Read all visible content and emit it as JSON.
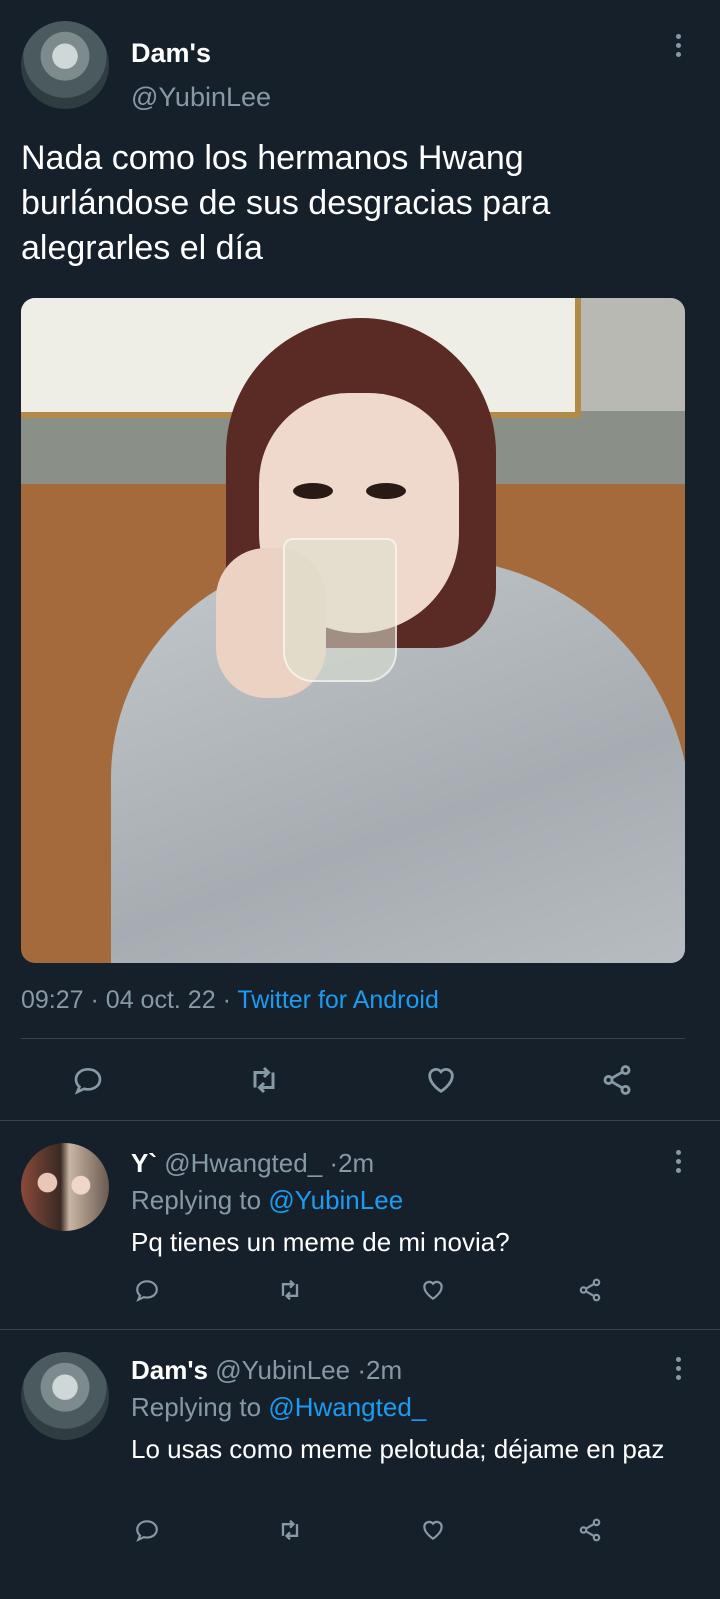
{
  "main_tweet": {
    "author_name": "Dam's",
    "author_handle": "@YubinLee",
    "text": "Nada como los hermanos Hwang burlándose de sus desgracias para alegrarles el día",
    "time": "09:27",
    "date": "04 oct. 22",
    "separator": "·",
    "source": "Twitter for Android",
    "media_icon": "photo"
  },
  "actions": [
    "reply-icon",
    "retweet-icon",
    "like-icon",
    "share-icon"
  ],
  "replies": [
    {
      "author_name": "Y`",
      "author_handle": "@Hwangted_",
      "separator": "·",
      "age": "2m",
      "replying_label": "Replying to",
      "replying_to": "@YubinLee",
      "text": "Pq tienes un meme de mi novia?"
    },
    {
      "author_name": "Dam's",
      "author_handle": "@YubinLee",
      "separator": "·",
      "age": "2m",
      "replying_label": "Replying to",
      "replying_to": "@Hwangted_",
      "text": "Lo usas como meme pelotuda; déjame en paz"
    }
  ],
  "colors": {
    "background": "#15202b",
    "muted": "#8899a6",
    "link": "#1d9bf0",
    "divider": "#38444d"
  }
}
